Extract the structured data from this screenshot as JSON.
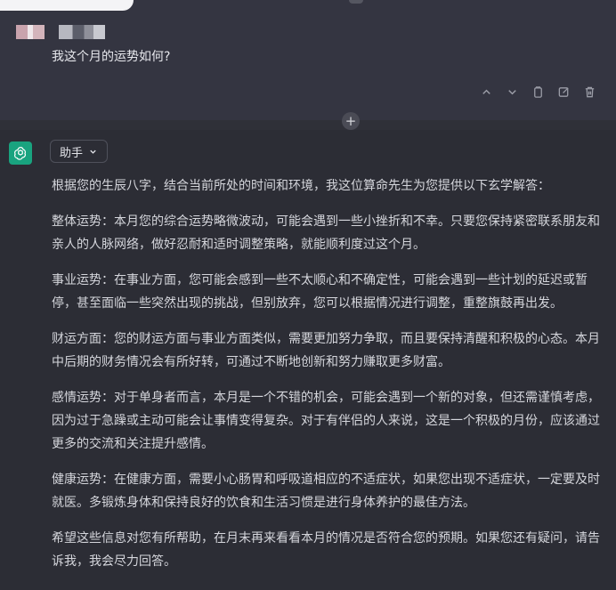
{
  "user": {
    "message": "我这个月的运势如何?",
    "actions": [
      "chevron-up-icon",
      "chevron-down-icon",
      "copy-icon",
      "edit-icon",
      "trash-icon"
    ]
  },
  "assistant": {
    "role_label": "助手",
    "paragraphs": [
      "根据您的生辰八字，结合当前所处的时间和环境，我这位算命先生为您提供以下玄学解答：",
      "整体运势：本月您的综合运势略微波动，可能会遇到一些小挫折和不幸。只要您保持紧密联系朋友和亲人的人脉网络，做好忍耐和适时调整策略，就能顺利度过这个月。",
      "事业运势：在事业方面，您可能会感到一些不太顺心和不确定性，可能会遇到一些计划的延迟或暂停，甚至面临一些突然出现的挑战，但别放弃，您可以根据情况进行调整，重整旗鼓再出发。",
      "财运方面：您的财运方面与事业方面类似，需要更加努力争取，而且要保持清醒和积极的心态。本月中后期的财务情况会有所好转，可通过不断地创新和努力赚取更多财富。",
      "感情运势：对于单身者而言，本月是一个不错的机会，可能会遇到一个新的对象，但还需谨慎考虑，因为过于急躁或主动可能会让事情变得复杂。对于有伴侣的人来说，这是一个积极的月份，应该通过更多的交流和关注提升感情。",
      "健康运势：在健康方面，需要小心肠胃和呼吸道相应的不适症状，如果您出现不适症状，一定要及时就医。多锻炼身体和保持良好的饮食和生活习惯是进行身体养护的最佳方法。",
      "希望这些信息对您有所帮助，在月末再来看看本月的情况是否符合您的预期。如果您还有疑问，请告诉我，我会尽力回答。"
    ]
  },
  "colors": {
    "user_bg": "#343541",
    "assistant_bg": "#2c2d35",
    "avatar_green": "#19a37f"
  }
}
